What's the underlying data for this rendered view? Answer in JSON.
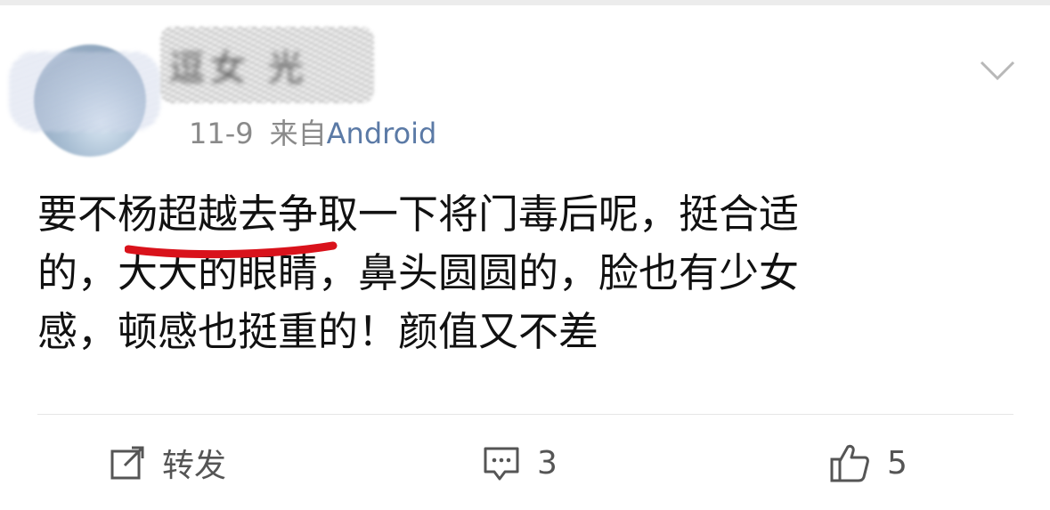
{
  "post": {
    "author": {
      "name_obscured": "逗女 光"
    },
    "date": "11-9",
    "source_prefix": "来自",
    "source_app": "Android",
    "text_lines": [
      "要不杨超越去争取一下将门毒后呢，挺合适",
      "的，大大的眼睛，鼻头圆圆的，脸也有少女",
      "感，顿感也挺重的！颜值又不差"
    ],
    "highlight_color": "#d9121b"
  },
  "actions": {
    "repost_label": "转发",
    "comment_count": "3",
    "like_count": "5"
  },
  "icons": {
    "more": "chevron-down-icon",
    "repost": "share-edit-icon",
    "comment": "comment-bubble-icon",
    "like": "thumbs-up-icon"
  },
  "colors": {
    "link": "#5b7aa6",
    "meta": "#8a8a8a",
    "text": "#111111"
  }
}
